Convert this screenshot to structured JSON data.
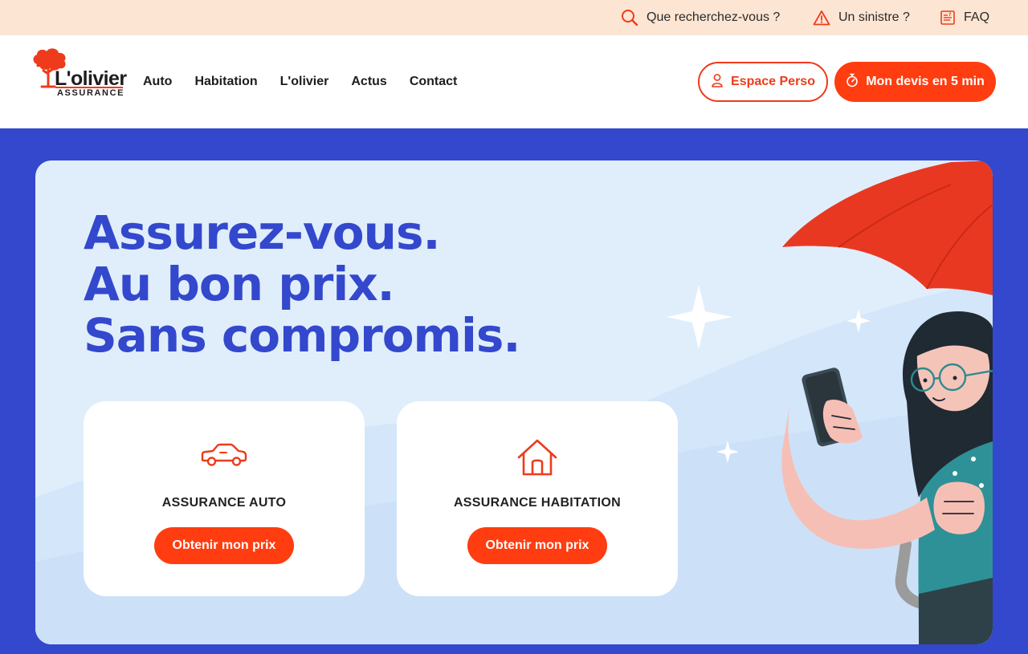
{
  "topbar": {
    "search_label": "Que recherchez-vous ?",
    "sinistre_label": "Un sinistre ?",
    "faq_label": "FAQ"
  },
  "header": {
    "logo_name": "L'olivier",
    "logo_tagline": "ASSURANCE",
    "nav": [
      "Auto",
      "Habitation",
      "L'olivier",
      "Actus",
      "Contact"
    ],
    "espace_perso_label": "Espace Perso",
    "devis_label": "Mon devis en 5 min"
  },
  "hero": {
    "headline": [
      "Assurez-vous.",
      "Au bon prix.",
      "Sans compromis."
    ],
    "cards": [
      {
        "title": "ASSURANCE AUTO",
        "cta": "Obtenir mon prix",
        "icon": "car-icon"
      },
      {
        "title": "ASSURANCE HABITATION",
        "cta": "Obtenir mon prix",
        "icon": "house-icon"
      }
    ]
  },
  "colors": {
    "brand_red": "#ff3d10",
    "brand_blue": "#3348cc",
    "topbar_bg": "#fde5d3",
    "hero_bg": "#e0eefb"
  }
}
